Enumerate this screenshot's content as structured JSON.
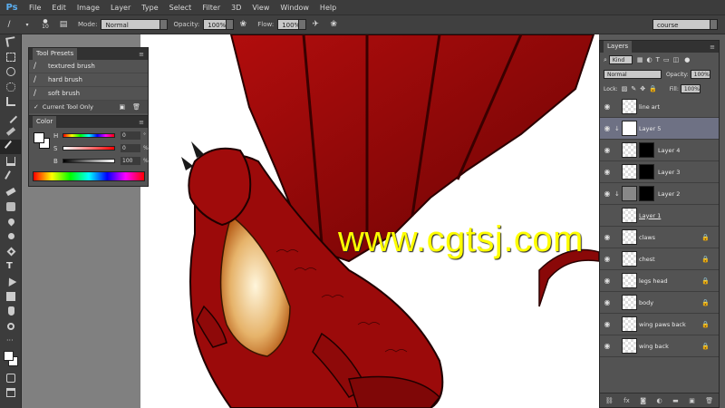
{
  "app": {
    "logo": "Ps"
  },
  "menu": [
    "File",
    "Edit",
    "Image",
    "Layer",
    "Type",
    "Select",
    "Filter",
    "3D",
    "View",
    "Window",
    "Help"
  ],
  "options": {
    "brush_size": "10",
    "mode_label": "Mode:",
    "mode_value": "Normal",
    "opacity_label": "Opacity:",
    "opacity_value": "100%",
    "flow_label": "Flow:",
    "flow_value": "100%",
    "workspace": "course"
  },
  "tool_presets": {
    "title": "Tool Presets",
    "items": [
      "textured brush",
      "hard brush",
      "soft brush"
    ],
    "current_tool_only": "Current Tool Only"
  },
  "color_panel": {
    "title": "Color",
    "h_label": "H",
    "h_value": "0",
    "s_label": "S",
    "s_value": "0",
    "b_label": "B",
    "b_value": "100",
    "h_unit": "°",
    "s_unit": "%",
    "b_unit": "%"
  },
  "layers_panel": {
    "title": "Layers",
    "kind": "Kind",
    "blend_mode": "Normal",
    "opacity_label": "Opacity:",
    "opacity_value": "100%",
    "lock_label": "Lock:",
    "fill_label": "Fill:",
    "fill_value": "100%",
    "layers": [
      {
        "name": "line art"
      },
      {
        "name": "Layer 5"
      },
      {
        "name": "Layer 4"
      },
      {
        "name": "Layer 3"
      },
      {
        "name": "Layer 2"
      },
      {
        "name": "Layer 1"
      },
      {
        "name": "claws"
      },
      {
        "name": "chest"
      },
      {
        "name": "legs head"
      },
      {
        "name": "body"
      },
      {
        "name": "wing paws back"
      },
      {
        "name": "wing back"
      }
    ],
    "footer": [
      "fx"
    ]
  },
  "watermark": "www.cgtsj.com",
  "colors": {
    "accent": "#5aaef0",
    "watermark": "#ffff00",
    "dragon_red": "#9b0a0a",
    "selected_layer": "#6e7184"
  }
}
